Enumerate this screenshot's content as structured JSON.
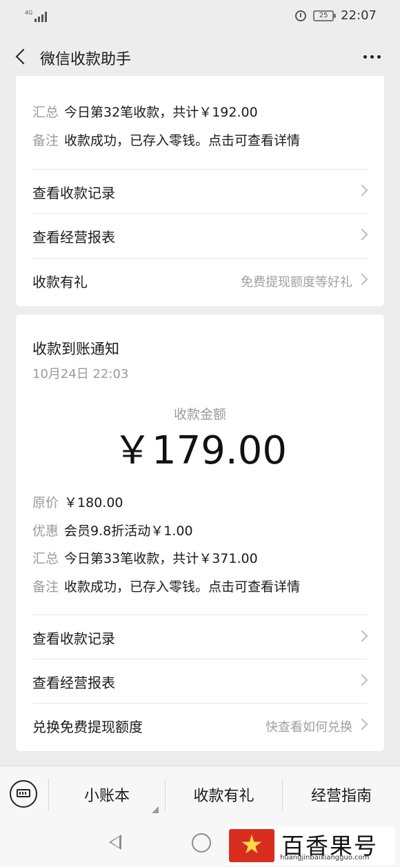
{
  "status_bar": {
    "network": "4G",
    "battery": "25",
    "time": "22:07"
  },
  "nav": {
    "title": "微信收款助手"
  },
  "card1": {
    "summary": {
      "key": "汇总",
      "value": "今日第32笔收款，共计￥192.00"
    },
    "note": {
      "key": "备注",
      "value": "收款成功，已存入零钱。点击可查看详情"
    },
    "rows": [
      {
        "label": "查看收款记录",
        "hint": ""
      },
      {
        "label": "查看经营报表",
        "hint": ""
      },
      {
        "label": "收款有礼",
        "hint": "免费提现额度等好礼"
      }
    ]
  },
  "card2": {
    "title": "收款到账通知",
    "time": "10月24日 22:03",
    "amount_label": "收款金额",
    "amount": "￥179.00",
    "original": {
      "key": "原价",
      "value": "￥180.00"
    },
    "discount": {
      "key": "优惠",
      "value": "会员9.8折活动￥1.00"
    },
    "summary": {
      "key": "汇总",
      "value": "今日第33笔收款，共计￥371.00"
    },
    "note": {
      "key": "备注",
      "value": "收款成功，已存入零钱。点击可查看详情"
    },
    "rows": [
      {
        "label": "查看收款记录",
        "hint": ""
      },
      {
        "label": "查看经营报表",
        "hint": ""
      },
      {
        "label": "兑换免费提现额度",
        "hint": "快查看如何兑换"
      }
    ]
  },
  "bottom_menu": {
    "items": [
      "小账本",
      "收款有礼",
      "经营指南"
    ]
  },
  "watermark": {
    "text": "百香果号",
    "url": "huangjinbaixiangguo.com"
  }
}
